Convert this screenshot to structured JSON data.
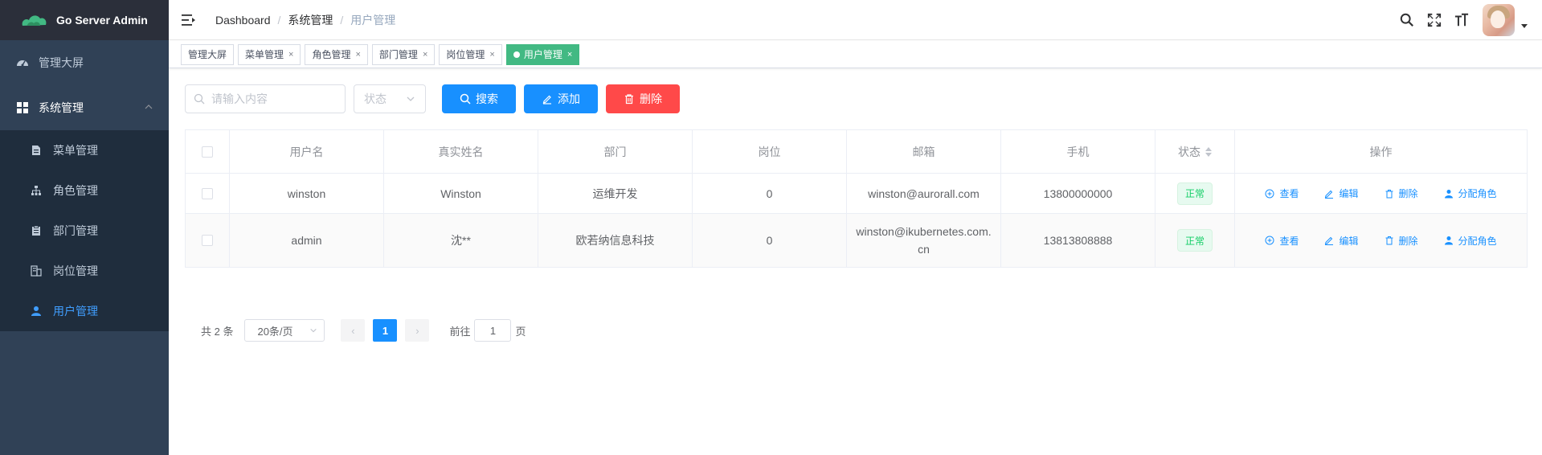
{
  "app": {
    "title": "Go Server Admin"
  },
  "sidebar": {
    "items": [
      {
        "label": "管理大屏",
        "icon": "dashboard-icon"
      },
      {
        "label": "系统管理",
        "icon": "grid-icon",
        "expanded": true
      }
    ],
    "submenu": [
      {
        "label": "菜单管理",
        "icon": "document-icon"
      },
      {
        "label": "角色管理",
        "icon": "tree-icon"
      },
      {
        "label": "部门管理",
        "icon": "clipboard-icon"
      },
      {
        "label": "岗位管理",
        "icon": "building-icon"
      },
      {
        "label": "用户管理",
        "icon": "user-icon",
        "active": true
      }
    ]
  },
  "navbar": {
    "breadcrumb": [
      "Dashboard",
      "系统管理",
      "用户管理"
    ],
    "separator": "/"
  },
  "tags": [
    {
      "label": "管理大屏",
      "closable": false
    },
    {
      "label": "菜单管理",
      "closable": true
    },
    {
      "label": "角色管理",
      "closable": true
    },
    {
      "label": "部门管理",
      "closable": true
    },
    {
      "label": "岗位管理",
      "closable": true
    },
    {
      "label": "用户管理",
      "closable": true,
      "active": true
    }
  ],
  "tag_close": "×",
  "filter": {
    "search_placeholder": "请输入内容",
    "status_placeholder": "状态",
    "search_label": "搜索",
    "add_label": "添加",
    "delete_label": "删除"
  },
  "table": {
    "headers": [
      "用户名",
      "真实姓名",
      "部门",
      "岗位",
      "邮箱",
      "手机",
      "状态",
      "操作"
    ],
    "rows": [
      {
        "username": "winston",
        "realname": "Winston",
        "dept": "运维开发",
        "post": "0",
        "email": "winston@aurorall.com",
        "phone": "13800000000",
        "status": "正常"
      },
      {
        "username": "admin",
        "realname": "沈**",
        "dept": "欧若纳信息科技",
        "post": "0",
        "email": "winston@ikubernetes.com.cn",
        "phone": "13813808888",
        "status": "正常"
      }
    ],
    "actions": [
      "查看",
      "编辑",
      "删除",
      "分配角色"
    ]
  },
  "pagination": {
    "total_text": "共 2 条",
    "page_size": "20条/页",
    "current_page": "1",
    "goto_label": "前往",
    "goto_value": "1",
    "page_suffix": "页",
    "prev": "‹",
    "next": "›"
  },
  "colors": {
    "sidebar_bg": "#304156",
    "accent": "#1890ff",
    "danger": "#ff4949",
    "active_tag": "#42b983",
    "success": "#13ce66"
  }
}
